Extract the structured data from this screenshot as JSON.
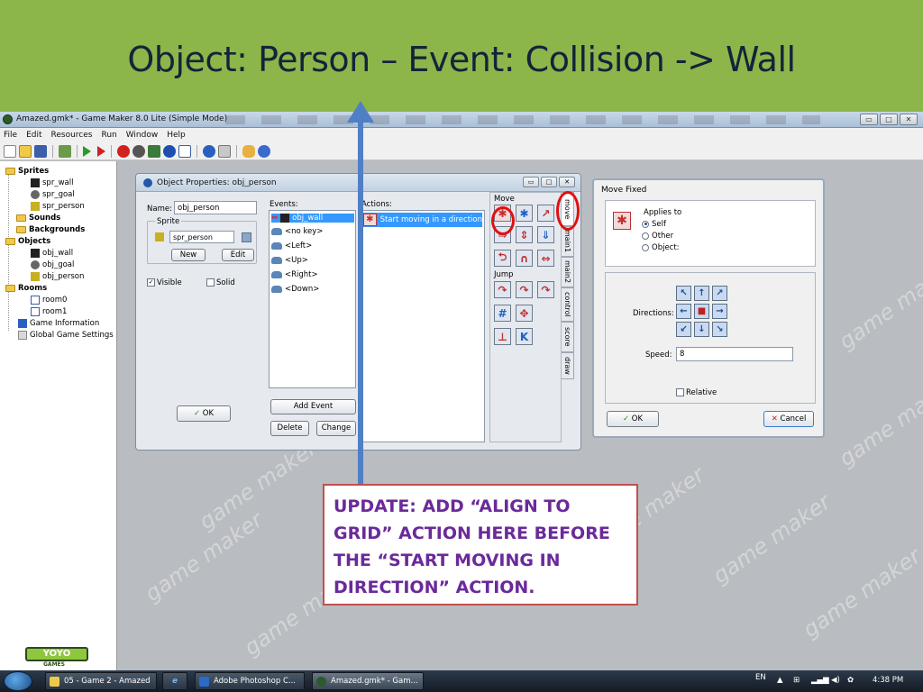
{
  "slide": {
    "title": "Object: Person – Event: Collision -> Wall"
  },
  "app": {
    "title": "Amazed.gmk* - Game Maker 8.0 Lite (Simple Mode)",
    "menu": [
      "File",
      "Edit",
      "Resources",
      "Run",
      "Window",
      "Help"
    ]
  },
  "tree": {
    "sprites": "Sprites",
    "spr_wall": "spr_wall",
    "spr_goal": "spr_goal",
    "spr_person": "spr_person",
    "sounds": "Sounds",
    "backgrounds": "Backgrounds",
    "objects": "Objects",
    "obj_wall": "obj_wall",
    "obj_goal": "obj_goal",
    "obj_person": "obj_person",
    "rooms": "Rooms",
    "room0": "room0",
    "room1": "room1",
    "game_info": "Game Information",
    "global_settings": "Global Game Settings"
  },
  "logo": {
    "brand": "YOYO",
    "sub": "GAMES"
  },
  "watermark": "game maker",
  "object_window": {
    "title": "Object Properties: obj_person",
    "name_label": "Name:",
    "name_value": "obj_person",
    "sprite_group": "Sprite",
    "sprite_value": "spr_person",
    "new_btn": "New",
    "edit_btn": "Edit",
    "visible_label": "Visible",
    "solid_label": "Solid",
    "ok_btn": "OK",
    "events_label": "Events:",
    "events": [
      "obj_wall",
      "<no key>",
      "<Left>",
      "<Up>",
      "<Right>",
      "<Down>"
    ],
    "actions_label": "Actions:",
    "action_item": "Start moving in a direction",
    "add_event_btn": "Add Event",
    "delete_btn": "Delete",
    "change_btn": "Change",
    "move_group": "Move",
    "jump_group": "Jump",
    "tabs": [
      "move",
      "main1",
      "main2",
      "control",
      "score",
      "draw"
    ]
  },
  "move_fixed": {
    "title": "Move Fixed",
    "applies_to": "Applies to",
    "self": "Self",
    "other": "Other",
    "object": "Object:",
    "directions_label": "Directions:",
    "speed_label": "Speed:",
    "speed_value": "8",
    "relative_label": "Relative",
    "ok_btn": "OK",
    "cancel_btn": "Cancel"
  },
  "callout": {
    "text": "UPDATE: ADD “ALIGN TO GRID” ACTION HERE BEFORE THE “START MOVING IN DIRECTION” ACTION."
  },
  "taskbar": {
    "tasks": [
      "05 - Game 2 - Amazed",
      "Adobe Photoshop C...",
      "Amazed.gmk* - Gam..."
    ],
    "lang": "EN",
    "clock": "4:38 PM"
  },
  "colors": {
    "slide_green": "#8cb54a",
    "title_text": "#14233a",
    "arrow": "#4f7fc4",
    "highlight_red": "#e01010",
    "callout_border": "#c0504d",
    "callout_text": "#6a2a9a"
  }
}
